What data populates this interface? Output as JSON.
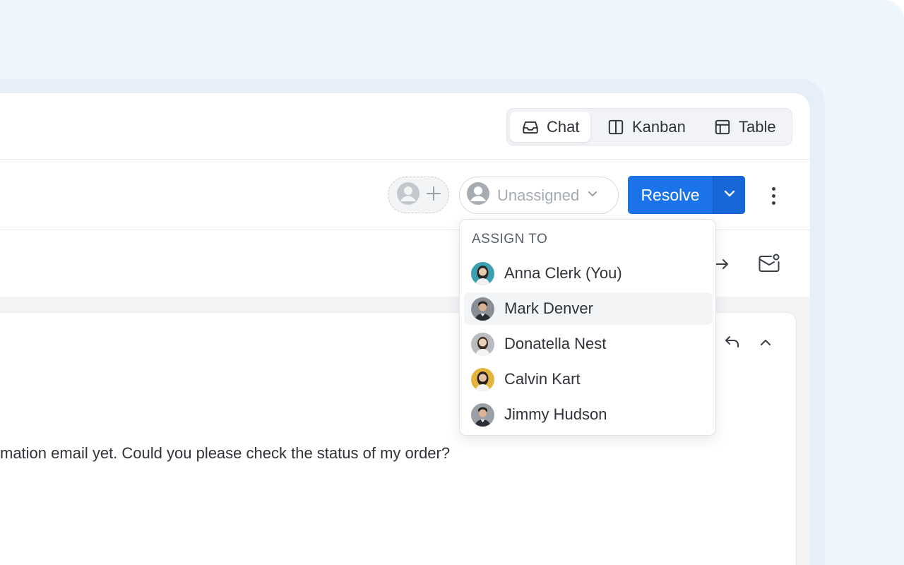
{
  "views": {
    "tabs": [
      {
        "label": "Chat",
        "icon": "inbox-icon",
        "active": true
      },
      {
        "label": "Kanban",
        "icon": "columns-icon",
        "active": false
      },
      {
        "label": "Table",
        "icon": "table-icon",
        "active": false
      }
    ]
  },
  "toolbar": {
    "assignee_placeholder": "Unassigned",
    "resolve_label": "Resolve",
    "accent_color": "#1a73e8"
  },
  "dropdown": {
    "header": "ASSIGN TO",
    "items": [
      {
        "name": "Anna Clerk (You)",
        "avatar_bg": "#3a9fb0"
      },
      {
        "name": "Mark Denver",
        "avatar_bg": "#8a8f96",
        "highlighted": true
      },
      {
        "name": "Donatella Nest",
        "avatar_bg": "#b9bcc1"
      },
      {
        "name": "Calvin Kart",
        "avatar_bg": "#e3b53c"
      },
      {
        "name": "Jimmy Hudson",
        "avatar_bg": "#9aa0a6"
      }
    ]
  },
  "message": {
    "text": "mation email yet. Could you please check the status of my order?"
  }
}
